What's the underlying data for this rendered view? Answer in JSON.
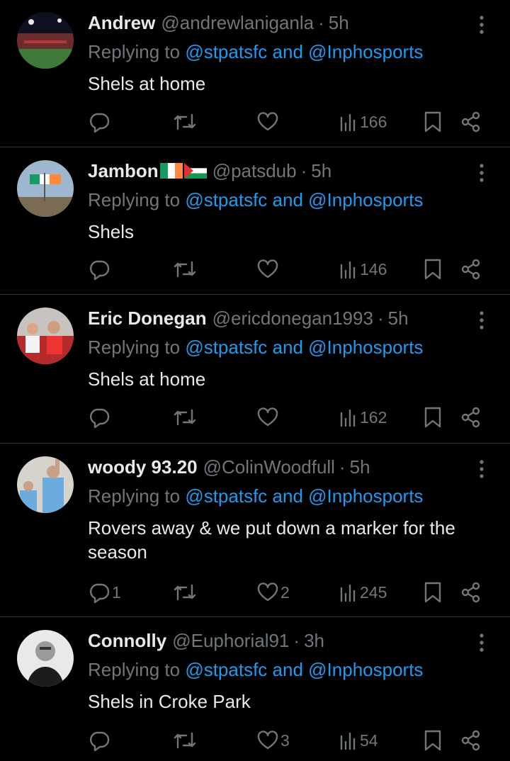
{
  "replying_prefix": "Replying to",
  "replying_joiner": "and",
  "colors": {
    "background": "#000000",
    "text": "#e7e9ea",
    "secondary": "#71767b",
    "link": "#1d9bf0",
    "divider": "#2f3336"
  },
  "icons": {
    "reply": "reply-icon",
    "retweet": "retweet-icon",
    "like": "like-icon",
    "views": "views-icon",
    "bookmark": "bookmark-icon",
    "share": "share-icon",
    "more": "more-icon"
  },
  "replies": [
    {
      "name": "Andrew",
      "handle": "@andrewlaniganla",
      "time": "5h",
      "mentions": [
        "@stpatsfc",
        "@Inphosports"
      ],
      "text": "Shels at home",
      "reply_count": "",
      "like_count": "",
      "views": "166"
    },
    {
      "name": "Jambon",
      "handle": "@patsdub",
      "time": "5h",
      "mentions": [
        "@stpatsfc",
        "@Inphosports"
      ],
      "text": "Shels",
      "reply_count": "",
      "like_count": "",
      "views": "146"
    },
    {
      "name": "Eric Donegan",
      "handle": "@ericdonegan1993",
      "time": "5h",
      "mentions": [
        "@stpatsfc",
        "@Inphosports"
      ],
      "text": "Shels at home",
      "reply_count": "",
      "like_count": "",
      "views": "162"
    },
    {
      "name": "woody 93.20",
      "handle": "@ColinWoodfull",
      "time": "5h",
      "mentions": [
        "@stpatsfc",
        "@Inphosports"
      ],
      "text": "Rovers away & we put down a marker for the season",
      "reply_count": "1",
      "like_count": "2",
      "views": "245"
    },
    {
      "name": "Connolly",
      "handle": "@Euphorial91",
      "time": "3h",
      "mentions": [
        "@stpatsfc",
        "@Inphosports"
      ],
      "text": "Shels in Croke Park",
      "reply_count": "",
      "like_count": "3",
      "views": "54"
    }
  ]
}
